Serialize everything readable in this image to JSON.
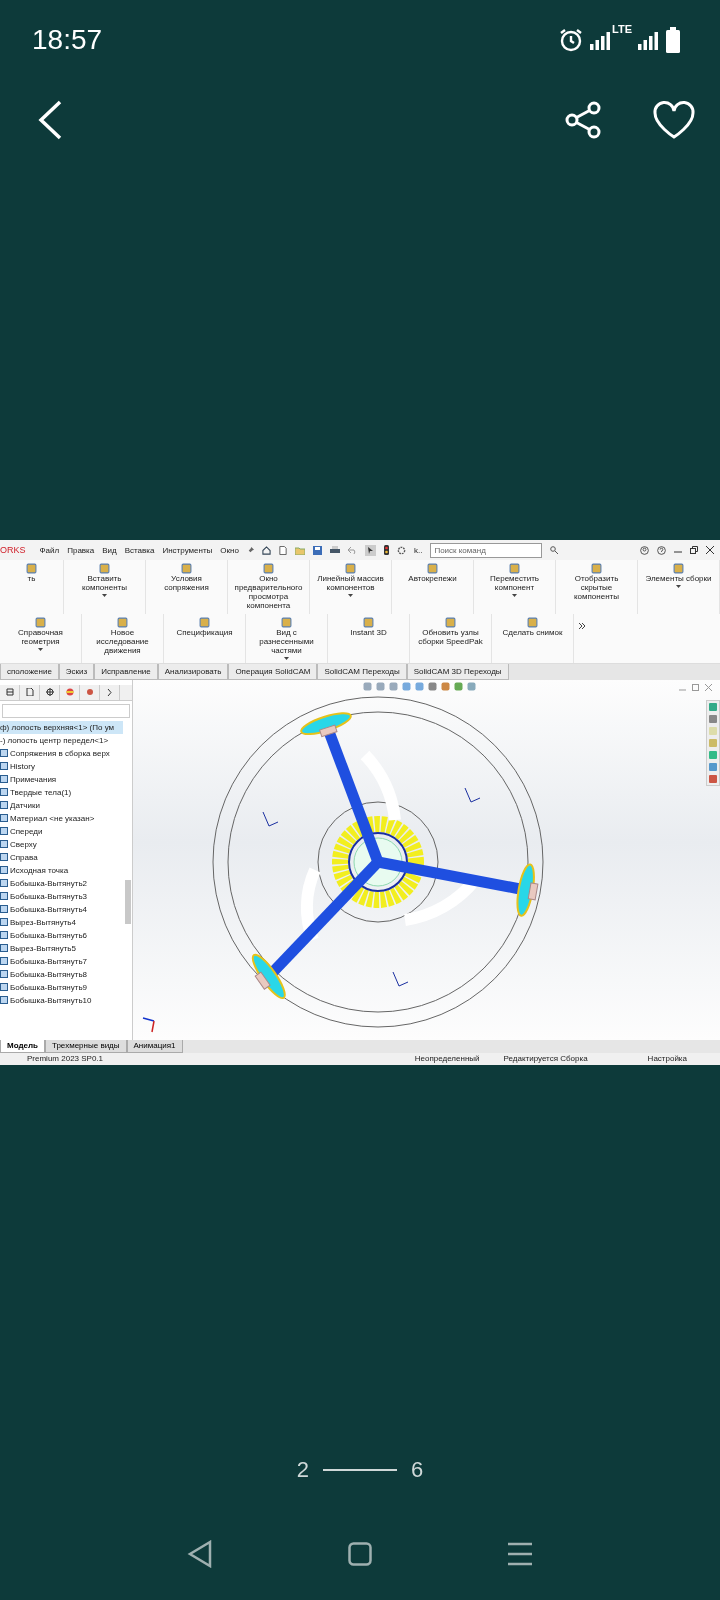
{
  "status_bar": {
    "time": "18:57",
    "network": "LTE"
  },
  "screenshot": {
    "app_name": "ORKS",
    "menu": [
      "Файл",
      "Правка",
      "Вид",
      "Вставка",
      "Инструменты",
      "Окно"
    ],
    "toolbar_overflow": "k..",
    "search": {
      "placeholder": "Поиск команд"
    },
    "ribbon": [
      {
        "label": "ть",
        "dropdown": false
      },
      {
        "label": "Вставить компоненты",
        "dropdown": true
      },
      {
        "label": "Условия сопряжения",
        "dropdown": false
      },
      {
        "label": "Окно предварительного просмотра компонента",
        "dropdown": false
      },
      {
        "label": "Линейный массив компонентов",
        "dropdown": true
      },
      {
        "label": "Автокрепежи",
        "dropdown": false
      },
      {
        "label": "Переместить компонент",
        "dropdown": true
      },
      {
        "label": "Отобразить скрытые компоненты",
        "dropdown": false
      },
      {
        "label": "Элементы сборки",
        "dropdown": true
      },
      {
        "label": "Справочная геометрия",
        "dropdown": true
      },
      {
        "label": "Новое исследование движения",
        "dropdown": false
      },
      {
        "label": "Спецификация",
        "dropdown": false
      },
      {
        "label": "Вид с разнесенными частями",
        "dropdown": true
      },
      {
        "label": "Instant 3D",
        "dropdown": false
      },
      {
        "label": "Обновить узлы сборки SpeedPak",
        "dropdown": false
      },
      {
        "label": "Сделать снимок",
        "dropdown": false
      }
    ],
    "tabs": [
      {
        "label": "сположение",
        "selected": false
      },
      {
        "label": "Эскиз",
        "selected": false
      },
      {
        "label": "Исправление",
        "selected": false
      },
      {
        "label": "Анализировать",
        "selected": false
      },
      {
        "label": "Операция SolidCAM",
        "selected": false
      },
      {
        "label": "SolidCAM Переходы",
        "selected": false
      },
      {
        "label": "SolidCAM 3D Переходы",
        "selected": false
      }
    ],
    "tree": [
      {
        "label": "ф) лопость верхняя<1> (По ум",
        "selected": true
      },
      {
        "label": "-) лопость центр передел<1>",
        "selected": false,
        "children": [
          {
            "label": "Сопряжения в сборка верх",
            "selected": false
          },
          {
            "label": "History",
            "selected": false
          },
          {
            "label": "Примечания",
            "selected": false
          },
          {
            "label": "Твердые тела(1)",
            "selected": false
          },
          {
            "label": "Датчики",
            "selected": false
          },
          {
            "label": "Материал <не указан>",
            "selected": false
          },
          {
            "label": "Спереди",
            "selected": false
          },
          {
            "label": "Сверху",
            "selected": false
          },
          {
            "label": "Справа",
            "selected": false
          },
          {
            "label": "Исходная точка",
            "selected": false
          },
          {
            "label": "Бобышка-Вытянуть2",
            "selected": false
          },
          {
            "label": "Бобышка-Вытянуть3",
            "selected": false
          },
          {
            "label": "Бобышка-Вытянуть4",
            "selected": false
          },
          {
            "label": "Вырез-Вытянуть4",
            "selected": false
          },
          {
            "label": "Бобышка-Вытянуть6",
            "selected": false
          },
          {
            "label": "Вырез-Вытянуть5",
            "selected": false
          },
          {
            "label": "Бобышка-Вытянуть7",
            "selected": false
          },
          {
            "label": "Бобышка-Вытянуть8",
            "selected": false
          },
          {
            "label": "Бобышка-Вытянуть9",
            "selected": false
          },
          {
            "label": "Бобышка-Вытянуть10",
            "selected": false
          }
        ]
      }
    ],
    "bottom_tabs": [
      {
        "label": "Модель",
        "selected": true
      },
      {
        "label": "Трехмерные виды",
        "selected": false
      },
      {
        "label": "Анимация1",
        "selected": false
      }
    ],
    "status": [
      "Premium 2023 SP0.1",
      "Неопределенный",
      "Редактируется Сборка",
      "Настройка"
    ]
  },
  "pager": {
    "current": "2",
    "total": "6"
  }
}
